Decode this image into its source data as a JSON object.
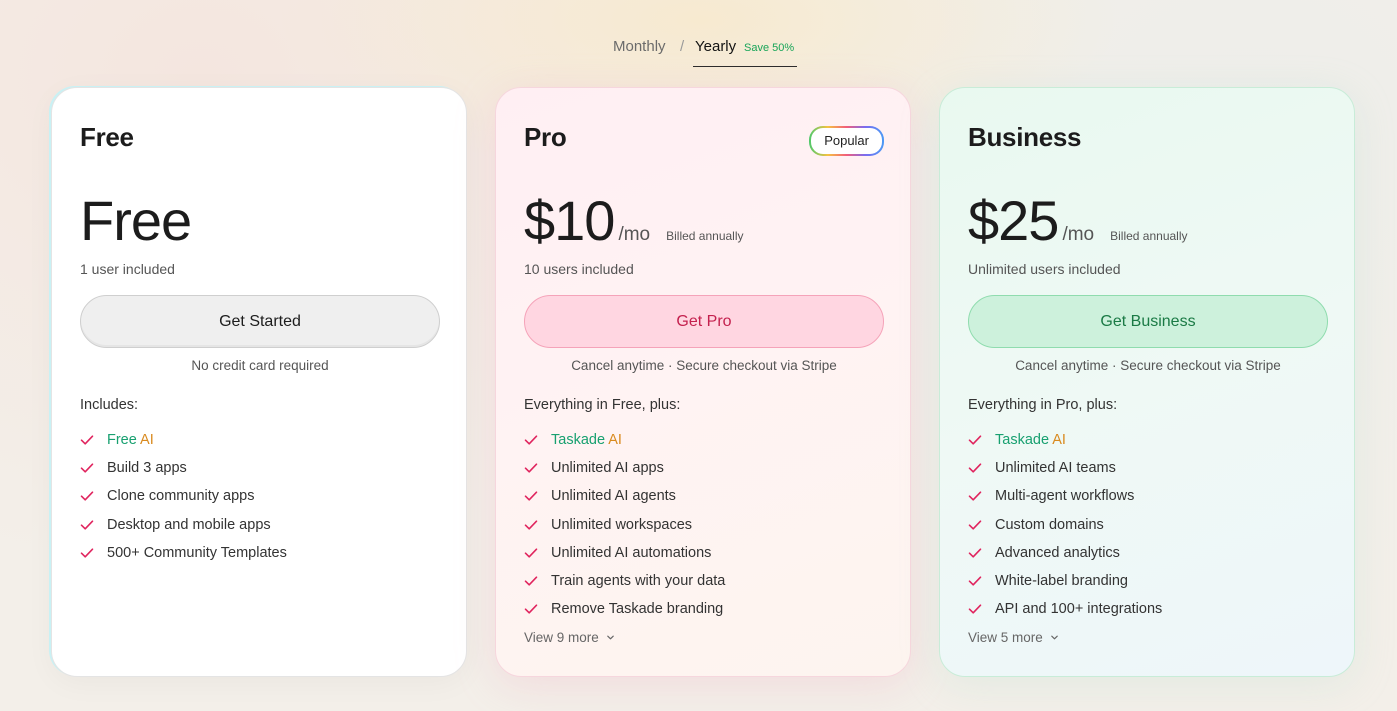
{
  "billing_toggle": {
    "monthly": "Monthly",
    "separator": "/",
    "yearly": "Yearly",
    "save": "Save 50%",
    "selected": "Yearly"
  },
  "plans": [
    {
      "name": "Free",
      "price": "Free",
      "per": "",
      "billed": "",
      "users": "1 user included",
      "cta": "Get Started",
      "note": "No credit card required",
      "includes": "Includes:",
      "features": [
        "Free AI",
        "Build 3 apps",
        "Clone community apps",
        "Desktop and mobile apps",
        "500+ Community Templates"
      ],
      "ai_feature": {
        "part1": "Free ",
        "part2": "AI"
      }
    },
    {
      "name": "Pro",
      "badge": "Popular",
      "price": "$10",
      "per": "/mo",
      "billed": "Billed annually",
      "users": "10 users included",
      "cta": "Get Pro",
      "note": "Cancel anytime · Secure checkout via Stripe",
      "includes": "Everything in Free, plus:",
      "features": [
        "Taskade AI",
        "Unlimited AI apps",
        "Unlimited AI agents",
        "Unlimited workspaces",
        "Unlimited AI automations",
        "Train agents with your data",
        "Remove Taskade branding"
      ],
      "ai_feature": {
        "part1": "Taskade ",
        "part2": "AI"
      },
      "more": "View 9 more"
    },
    {
      "name": "Business",
      "price": "$25",
      "per": "/mo",
      "billed": "Billed annually",
      "users": "Unlimited users included",
      "cta": "Get Business",
      "note": "Cancel anytime · Secure checkout via Stripe",
      "includes": "Everything in Pro, plus:",
      "features": [
        "Taskade AI",
        "Unlimited AI teams",
        "Multi-agent workflows",
        "Custom domains",
        "Advanced analytics",
        "White-label branding",
        "API and 100+ integrations"
      ],
      "ai_feature": {
        "part1": "Taskade ",
        "part2": "AI"
      },
      "more": "View 5 more"
    }
  ],
  "colors": {
    "check": "#e0245e",
    "ai_green": "#18a070",
    "ai_orange": "#d98a1e",
    "pro_accent": "#c4214e",
    "business_accent": "#1a7a45"
  },
  "icons": {
    "feature_bullet": "check-icon",
    "view_more": "chevron-down-icon"
  }
}
